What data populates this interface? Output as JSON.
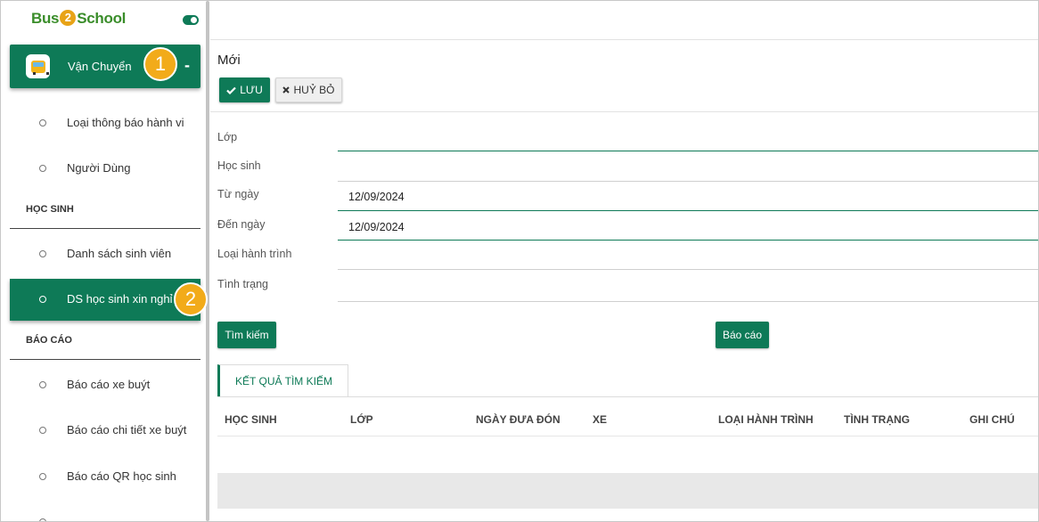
{
  "brand": {
    "logo_part1": "Bus",
    "logo_part2": "2",
    "logo_part3": "School"
  },
  "sidebar": {
    "group_label": "Vận Chuyển",
    "collapse_symbol": "-",
    "items_top": [
      {
        "label": "Loại thông báo hành vi"
      },
      {
        "label": "Người Dùng"
      }
    ],
    "section_students": "HỌC SINH",
    "items_students": [
      {
        "label": "Danh sách sinh viên"
      },
      {
        "label": "DS học sinh xin nghỉ"
      }
    ],
    "section_reports": "BÁO CÁO",
    "items_reports": [
      {
        "label": "Báo cáo xe buýt"
      },
      {
        "label": "Báo cáo chi tiết xe buýt"
      },
      {
        "label": "Báo cáo QR học sinh"
      }
    ]
  },
  "badges": {
    "one": "1",
    "two": "2"
  },
  "main": {
    "title": "Mới",
    "save_label": "LƯU",
    "cancel_label": "HUỶ BỎ",
    "fields": {
      "class_label": "Lớp",
      "student_label": "Học sinh",
      "from_label": "Từ ngày",
      "from_value": "12/09/2024",
      "to_label": "Đến ngày",
      "to_value": "12/09/2024",
      "trip_type_label": "Loại hành trình",
      "status_label": "Tình trạng"
    },
    "search_label": "Tìm kiếm",
    "report_label": "Báo cáo",
    "results_tab": "KẾT QUẢ TÌM KIẾM",
    "columns": [
      "HỌC SINH",
      "LỚP",
      "NGÀY ĐƯA ĐÓN",
      "XE",
      "LOẠI HÀNH TRÌNH",
      "TÌNH TRẠNG",
      "GHI CHÚ"
    ]
  },
  "colors": {
    "primary": "#0e7a57",
    "badge": "#f2ab1a"
  }
}
